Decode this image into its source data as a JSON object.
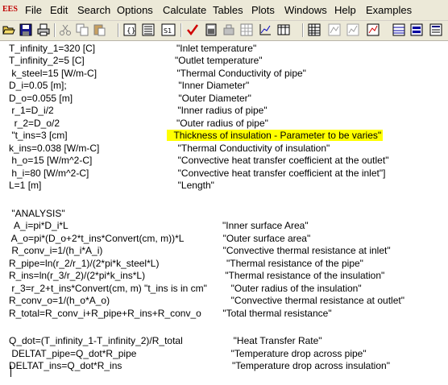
{
  "menubar": {
    "app_icon": "EES",
    "items": [
      "File",
      "Edit",
      "Search",
      "Options",
      "Calculate",
      "Tables",
      "Plots",
      "Windows",
      "Help",
      "Examples"
    ]
  },
  "toolbar": {
    "buttons": [
      "open-folder-icon",
      "save-disk-icon",
      "print-icon",
      "cut-scissors-icon",
      "copy-icon",
      "paste-icon",
      "equations-window-icon",
      "formatted-equations-icon",
      "solution-window-icon",
      "check-equations-icon",
      "calculator-icon",
      "arrays-icon",
      "grid-icon",
      "plot-window-icon",
      "parametric-table-icon",
      "lookup-table-icon",
      "diagram-window-icon",
      "plot-2-icon",
      "report-icon",
      "help-icon",
      "extra-window-icon"
    ]
  },
  "editor": {
    "lines": [
      {
        "code": "T_infinity_1=320 [C]",
        "comment": "\"Inlet temperature\""
      },
      {
        "code": "T_infinity_2=5 [C]",
        "comment": "\"Outlet temperature\""
      },
      {
        "code": " k_steel=15 [W/m-C]",
        "comment": " \"Thermal Conductivity of pipe\""
      },
      {
        "code": "D_i=0.05 [m];",
        "comment": " \"Inner Diameter\""
      },
      {
        "code": "D_o=0.055 [m]",
        "comment": " \"Outer Diameter\""
      },
      {
        "code": " r_1=D_i/2",
        "comment": " \"Inner radius of pipe\""
      },
      {
        "code": "  r_2=D_o/2",
        "comment": "\"Outer radius of pipe\""
      },
      {
        "code": " \"t_ins=3 [cm]",
        "comment": "  Thickness of insulation - Parameter to be varies\""
      },
      {
        "code": "k_ins=0.038 [W/m-C]",
        "comment": "  \"Thermal Conductivity of insulation\""
      },
      {
        "code": " h_o=15 [W/m^2-C]",
        "comment": "  \"Convective heat transfer coefficient at the outlet\""
      },
      {
        "code": " h_i=80 [W/m^2-C]",
        "comment": "  \"Convective heat transfer coefficient at the inlet\"]"
      },
      {
        "code": "L=1 [m]",
        "comment": "  \"Length\""
      },
      {
        "code": "",
        "comment": ""
      },
      {
        "code": " \"ANALYSIS\"",
        "comment": ""
      },
      {
        "code": "  A_i=pi*D_i*L",
        "comment": "\"Inner surface Area\""
      },
      {
        "code": " A_o=pi*(D_o+2*t_ins*Convert(cm, m))*L",
        "comment": "  \"Outer surface area\""
      },
      {
        "code": " R_conv_i=1/(h_i*A_i)",
        "comment": "  \"Convective thermal resistance at inlet\""
      },
      {
        "code": "R_pipe=ln(r_2/r_1)/(2*pi*k_steel*L)",
        "comment": "   \"Thermal resistance of the pipe\""
      },
      {
        "code": "R_ins=ln(r_3/r_2)/(2*pi*k_ins*L)",
        "comment": "    \"Thermal resistance of the insulation\""
      },
      {
        "code": " r_3=r_2+t_ins*Convert(cm, m) \"t_ins is in cm\"",
        "comment": "  \"Outer radius of the insulation\""
      },
      {
        "code": "R_conv_o=1/(h_o*A_o)",
        "comment": "     \"Convective thermal resistance at outlet\""
      },
      {
        "code": "R_total=R_conv_i+R_pipe+R_ins+R_conv_o",
        "comment": " \"Total thermal resistance\""
      },
      {
        "code": "",
        "comment": ""
      },
      {
        "code": "Q_dot=(T_infinity_1-T_infinity_2)/R_total",
        "comment": "  \"Heat Transfer Rate\""
      },
      {
        "code": " DELTAT_pipe=Q_dot*R_pipe",
        "comment": "  \"Temperature drop across pipe\""
      },
      {
        "code": "DELTAT_ins=Q_dot*R_ins",
        "comment": "   \"Temperature drop across insulation\""
      }
    ]
  }
}
